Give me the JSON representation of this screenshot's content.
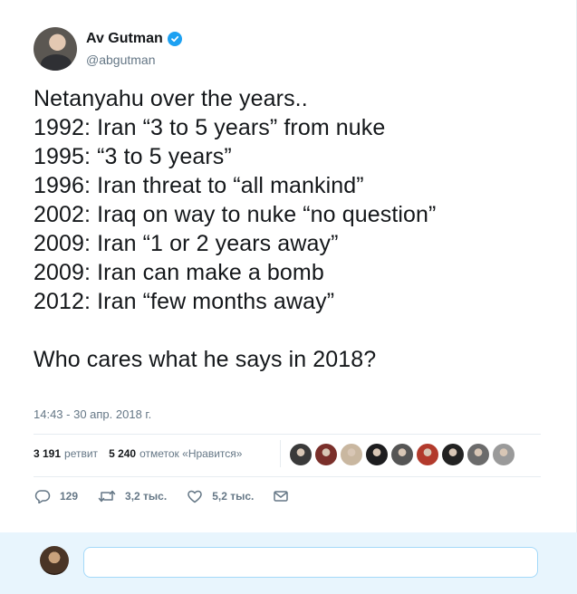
{
  "author": {
    "display_name": "Av Gutman",
    "handle": "@abgutman",
    "verified": true
  },
  "tweet": {
    "lines": [
      "Netanyahu over the years..",
      "1992: Iran “3 to 5 years” from nuke",
      "1995: “3 to 5 years”",
      "1996: Iran threat to “all mankind”",
      "2002: Iraq on way to nuke “no question”",
      "2009: Iran “1 or 2 years away”",
      "2009: Iran can make a bomb",
      "2012: Iran “few months away”",
      "",
      "Who cares what he says in 2018?"
    ],
    "timestamp": "14:43 - 30 апр. 2018 г."
  },
  "stats": {
    "retweets_count": "3 191",
    "retweets_label": "ретвит",
    "likes_count": "5 240",
    "likes_label": "отметок «Нравится»"
  },
  "likers": [
    {
      "icon": "liker-avatar",
      "color": "#3a3a3a"
    },
    {
      "icon": "liker-avatar",
      "color": "#7a2f2a"
    },
    {
      "icon": "liker-avatar",
      "color": "#c9b7a0"
    },
    {
      "icon": "liker-avatar",
      "color": "#1d1d1f"
    },
    {
      "icon": "liker-avatar",
      "color": "#555555"
    },
    {
      "icon": "liker-avatar",
      "color": "#b23a2c"
    },
    {
      "icon": "liker-avatar",
      "color": "#222222"
    },
    {
      "icon": "liker-avatar",
      "color": "#6b6b6b"
    },
    {
      "icon": "liker-avatar",
      "color": "#9a9a9a"
    }
  ],
  "actions": {
    "reply_count": "129",
    "retweet_count": "3,2 тыс.",
    "like_count": "5,2 тыс."
  },
  "colors": {
    "accent": "#1da1f2",
    "secondary_text": "#657786",
    "reply_bar": "#e8f5fd"
  }
}
